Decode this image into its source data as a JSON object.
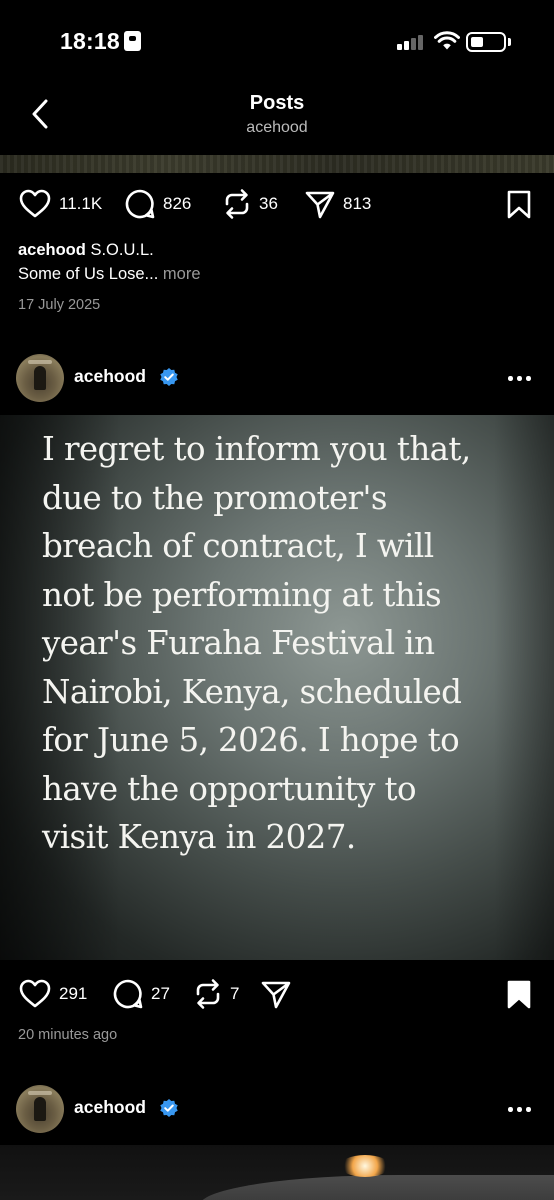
{
  "status_bar": {
    "time": "18:18"
  },
  "header": {
    "title": "Posts",
    "subtitle": "acehood"
  },
  "previous_post": {
    "likes": "11.1K",
    "comments": "826",
    "reposts": "36",
    "shares": "813",
    "caption_user": "acehood",
    "caption_line1": "S.O.U.L.",
    "caption_line2": "Some of Us Lose...",
    "more_label": "more",
    "date": "17 July 2025"
  },
  "post": {
    "username": "acehood",
    "verified": true,
    "statement": "I regret to inform you that,\ndue to the promoter's\nbreach of contract, I will\nnot be performing at this\nyear's Furaha Festival in\nNairobi, Kenya, scheduled\nfor June 5, 2026. I hope to\nhave the opportunity to\nvisit Kenya in 2027.",
    "likes": "291",
    "comments": "27",
    "reposts": "7",
    "bookmarked": true,
    "time_ago": "20 minutes ago"
  },
  "next_post": {
    "username": "acehood",
    "verified": true
  },
  "colors": {
    "background": "#000000",
    "verified_badge": "#3897f0",
    "secondary_text": "#999999"
  },
  "icons": [
    "back-chevron-icon",
    "heart-icon",
    "comment-icon",
    "repost-icon",
    "share-icon",
    "bookmark-icon",
    "verified-icon",
    "more-icon"
  ]
}
